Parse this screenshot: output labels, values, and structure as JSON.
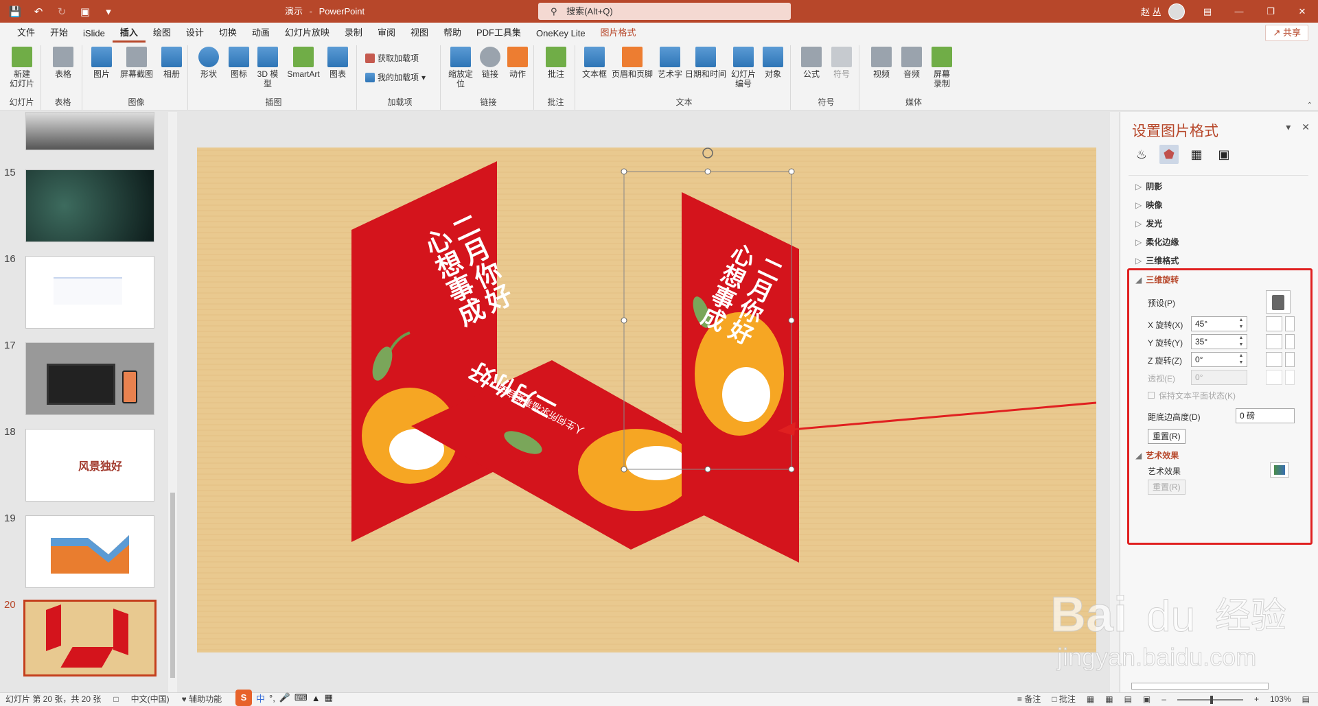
{
  "titlebar": {
    "doc_name": "演示",
    "separator": "-",
    "app_name": "PowerPoint",
    "search_placeholder": "搜索(Alt+Q)",
    "user_name": "赵 丛"
  },
  "menu_tabs": [
    "文件",
    "开始",
    "iSlide",
    "插入",
    "绘图",
    "设计",
    "切换",
    "动画",
    "幻灯片放映",
    "录制",
    "审阅",
    "视图",
    "帮助",
    "PDF工具集",
    "OneKey Lite",
    "图片格式"
  ],
  "active_tab": "插入",
  "share_label": "共享",
  "ribbon": {
    "groups": [
      {
        "label": "幻灯片",
        "buttons": [
          "新建\n幻灯片"
        ]
      },
      {
        "label": "表格",
        "buttons": [
          "表格"
        ]
      },
      {
        "label": "图像",
        "buttons": [
          "图片",
          "屏幕截图",
          "相册"
        ]
      },
      {
        "label": "插图",
        "buttons": [
          "形状",
          "图标",
          "3D 模\n型",
          "SmartArt",
          "图表"
        ]
      },
      {
        "label": "加载项",
        "buttons": [
          "获取加载项",
          "我的加载项"
        ]
      },
      {
        "label": "链接",
        "buttons": [
          "缩放定\n位",
          "链接",
          "动作"
        ]
      },
      {
        "label": "批注",
        "buttons": [
          "批注"
        ]
      },
      {
        "label": "文本",
        "buttons": [
          "文本框",
          "页眉和页脚",
          "艺术字",
          "日期和时间",
          "幻灯片\n编号",
          "对象"
        ]
      },
      {
        "label": "符号",
        "buttons": [
          "公式",
          "符号"
        ]
      },
      {
        "label": "媒体",
        "buttons": [
          "视频",
          "音频",
          "屏幕\n录制"
        ]
      }
    ]
  },
  "thumbnails": [
    {
      "num": "15"
    },
    {
      "num": "16"
    },
    {
      "num": "17"
    },
    {
      "num": "18",
      "text": "风景独好"
    },
    {
      "num": "19"
    },
    {
      "num": "20",
      "active": true
    }
  ],
  "slide": {
    "card_title": "二月你好",
    "card_sub": "心想事成",
    "card_footer": "人生何所求福事如自由"
  },
  "format_pane": {
    "title": "设置图片格式",
    "sections": [
      "阴影",
      "映像",
      "发光",
      "柔化边缘",
      "三维格式"
    ],
    "rotation_section": "三维旋转",
    "preset_label": "预设(P)",
    "x_label": "X 旋转(X)",
    "x_value": "45°",
    "y_label": "Y 旋转(Y)",
    "y_value": "35°",
    "z_label": "Z 旋转(Z)",
    "z_value": "0°",
    "persp_label": "透视(E)",
    "persp_value": "0°",
    "keep_flat_label": "保持文本平面状态(K)",
    "distance_label": "距底边高度(D)",
    "distance_value": "0 磅",
    "reset_label": "重置(R)",
    "art_section": "艺术效果",
    "art_label": "艺术效果",
    "art_reset_label": "重置(R)"
  },
  "statusbar": {
    "slide_info": "幻灯片 第 20 张，共 20 张",
    "language": "中文(中国)",
    "accessibility": "辅助功能",
    "notes": "备注",
    "comments": "批注",
    "zoom": "103%"
  },
  "ime": {
    "mode": "中"
  },
  "watermark": {
    "brand": "Bai",
    "brand2": "du",
    "suffix": "经验",
    "url": "jingyan.baidu.com"
  },
  "colors": {
    "accent": "#b7472a",
    "highlight": "#e02020",
    "card_red": "#d4141c"
  }
}
